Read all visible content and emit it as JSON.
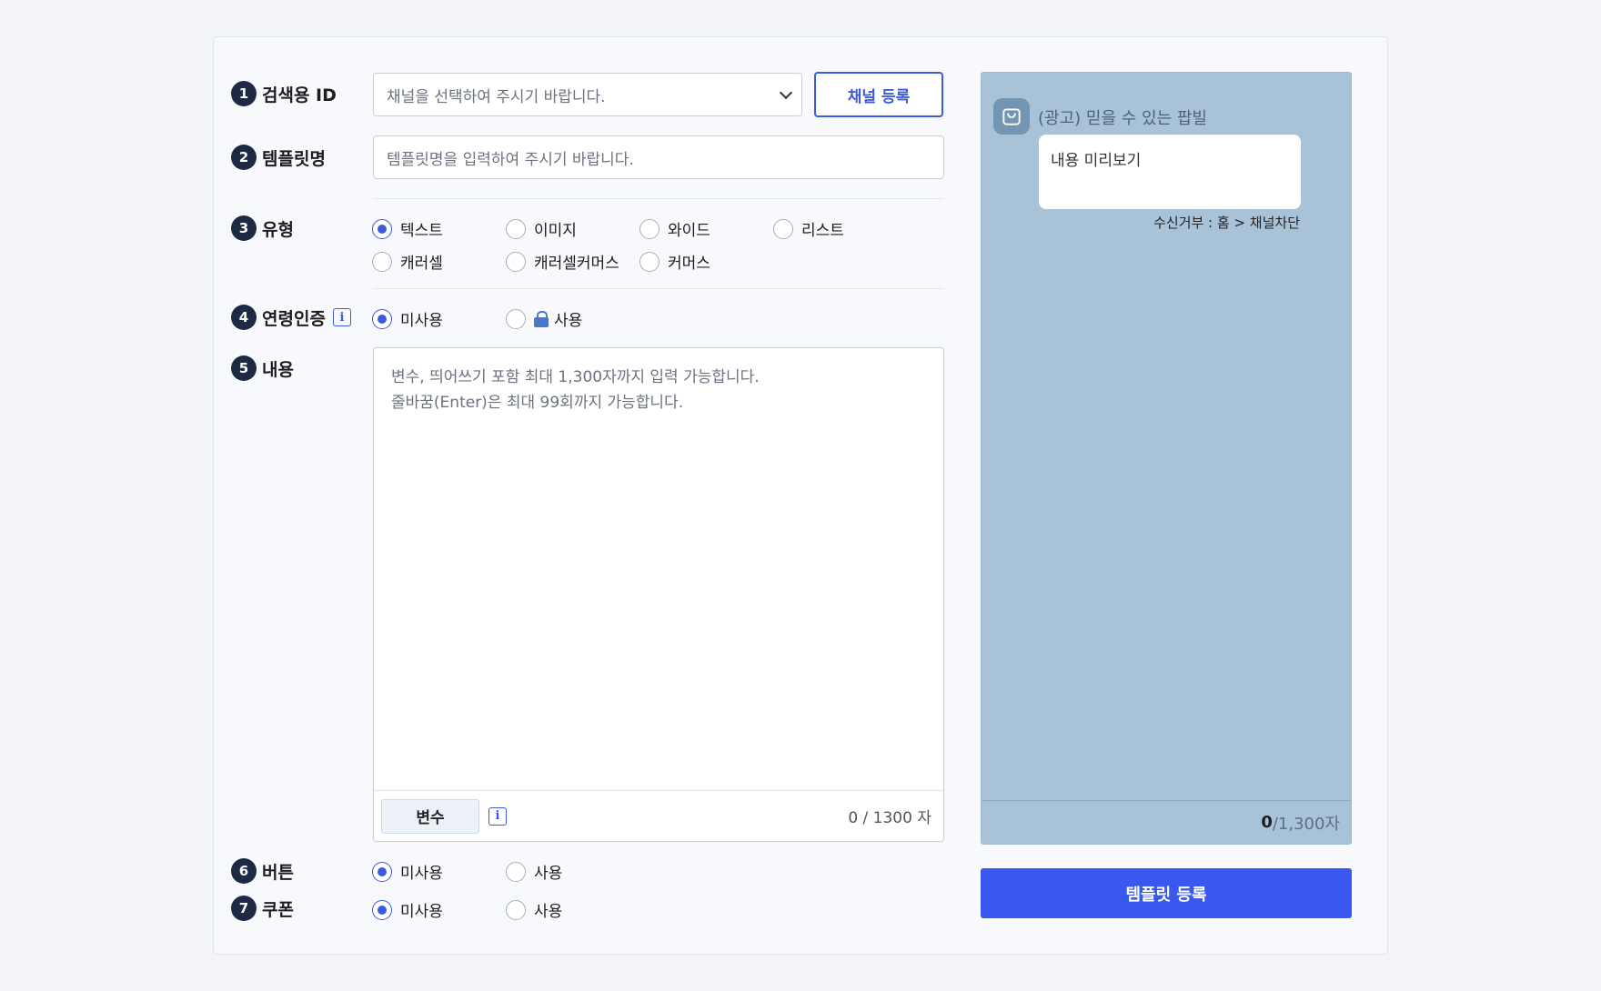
{
  "form": {
    "search_id": {
      "num": "1",
      "label": "검색용 ID",
      "placeholder": "채널을 선택하여 주시기 바랍니다.",
      "register_button": "채널 등록"
    },
    "template_name": {
      "num": "2",
      "label": "템플릿명",
      "placeholder": "템플릿명을 입력하여 주시기 바랍니다."
    },
    "type": {
      "num": "3",
      "label": "유형",
      "options": [
        "텍스트",
        "이미지",
        "와이드",
        "리스트",
        "캐러셀",
        "캐러셀커머스",
        "커머스"
      ],
      "selected": "텍스트"
    },
    "age_verification": {
      "num": "4",
      "label": "연령인증",
      "info": "i",
      "options": [
        "미사용",
        "사용"
      ],
      "selected": "미사용"
    },
    "content": {
      "num": "5",
      "label": "내용",
      "placeholder_line1": "변수, 띄어쓰기 포함 최대 1,300자까지 입력 가능합니다.",
      "placeholder_line2": "줄바꿈(Enter)은 최대 99회까지 가능합니다.",
      "variable_button": "변수",
      "info": "i",
      "counter": "0 / 1300 자"
    },
    "button": {
      "num": "6",
      "label": "버튼",
      "options": [
        "미사용",
        "사용"
      ],
      "selected": "미사용"
    },
    "coupon": {
      "num": "7",
      "label": "쿠폰",
      "options": [
        "미사용",
        "사용"
      ],
      "selected": "미사용"
    }
  },
  "preview": {
    "channel_name": "(광고) 믿을 수 있는 팝빌",
    "bubble_text": "내용 미리보기",
    "reject_text": "수신거부 : 홈 > 채널차단",
    "count_current": "0",
    "count_max": "/1,300자"
  },
  "submit_button": "템플릿 등록",
  "colors": {
    "accent": "#3b5bdb",
    "primary": "#3858f0",
    "preview_bg": "#a8c2d8",
    "badge": "#1e2a44"
  }
}
